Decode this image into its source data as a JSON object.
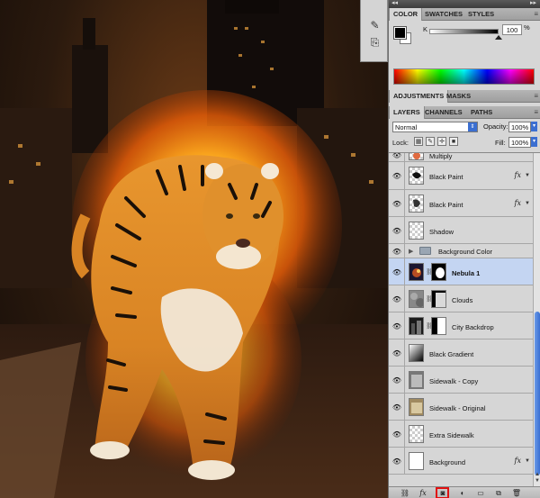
{
  "top_panel_tabs": {
    "color": "COLOR",
    "swatches": "SWATCHES",
    "styles": "STYLES"
  },
  "color_panel": {
    "channel_label": "K",
    "channel_value": "100",
    "channel_unit": "%",
    "foreground_color": "#000000",
    "background_color": "#ffffff"
  },
  "adjustments_tabs": {
    "adjustments": "ADJUSTMENTS",
    "masks": "MASKS"
  },
  "layers_tabs": {
    "layers": "LAYERS",
    "channels": "CHANNELS",
    "paths": "PATHS"
  },
  "layers_controls": {
    "blend_mode": "Normal",
    "opacity_label": "Opacity:",
    "opacity_value": "100%",
    "lock_label": "Lock:",
    "fill_label": "Fill:",
    "fill_value": "100%"
  },
  "layers": [
    {
      "name": "Multiply",
      "thumb": "checker",
      "fx": false
    },
    {
      "name": "Black Paint",
      "thumb": "paint",
      "fx": true
    },
    {
      "name": "Black Paint",
      "thumb": "paint2",
      "fx": true
    },
    {
      "name": "Shadow",
      "thumb": "checker",
      "fx": false
    },
    {
      "name": "Background Color",
      "thumb": "group",
      "fx": false
    },
    {
      "name": "Nebula 1",
      "thumb": "nebula",
      "fx": false,
      "selected": true
    },
    {
      "name": "Clouds",
      "thumb": "clouds",
      "fx": false
    },
    {
      "name": "City Backdrop",
      "thumb": "city",
      "fx": false
    },
    {
      "name": "Black Gradient",
      "thumb": "gradient",
      "fx": false
    },
    {
      "name": "Sidewalk - Copy",
      "thumb": "sidewalk",
      "fx": false
    },
    {
      "name": "Sidewalk - Original",
      "thumb": "sidewalk2",
      "fx": false
    },
    {
      "name": "Extra Sidewalk",
      "thumb": "checker",
      "fx": false
    },
    {
      "name": "Background",
      "thumb": "white",
      "fx": true
    }
  ],
  "fx_symbol": "fx",
  "footer_icons": [
    "link-layers-icon",
    "layer-style-icon",
    "add-layer-mask-icon",
    "adjustment-layer-icon",
    "new-group-icon",
    "new-layer-icon",
    "trash-icon"
  ],
  "colors": {
    "selected_layer": "#c4d5f2",
    "scroll_thumb": "#3a6fd2",
    "mask_highlight": "#e01010"
  }
}
